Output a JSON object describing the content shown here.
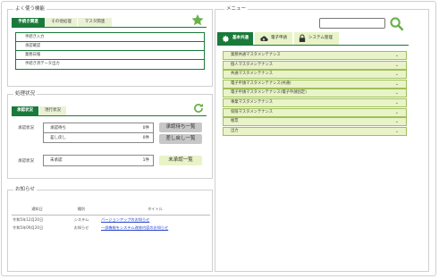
{
  "favorites": {
    "title": "よく使う機能",
    "tabs": [
      "手続き関連",
      "その他処理",
      "マスタ関連"
    ],
    "items": [
      "手続き入力",
      "承認確認",
      "業務日報",
      "手続き済データ出力"
    ]
  },
  "status": {
    "title": "処理状況",
    "tabs": [
      "承認状況",
      "現行状況"
    ],
    "rows": [
      {
        "label": "承認状況",
        "name": "承認待ち",
        "count": "0件",
        "button": "承認待ち一覧"
      },
      {
        "label": "",
        "name": "差し戻し",
        "count": "0件",
        "button": "差し戻し一覧"
      },
      {
        "label": "承認状況",
        "name": "未承認",
        "count": "1件",
        "button": "未承認一覧"
      }
    ]
  },
  "news": {
    "title": "お知らせ",
    "headers": [
      "通知日",
      "種別",
      "タイトル"
    ],
    "rows": [
      {
        "date": "令和5年12月20日",
        "type": "システム",
        "title": "バージョンアップのお知らせ"
      },
      {
        "date": "令和5年09月20日",
        "type": "お知らせ",
        "title": "一部機能をシステム改修内容のお知らせ"
      }
    ]
  },
  "menu": {
    "title": "メニュー",
    "search_placeholder": "",
    "tabs": [
      {
        "label": "基本共通",
        "icon": "gear-icon"
      },
      {
        "label": "電子申請",
        "icon": "cloud-upload-icon"
      },
      {
        "label": "システム管理",
        "icon": "lock-icon"
      }
    ],
    "items": [
      "業務共通マスタメンテナンス",
      "個人マスタメンテナンス",
      "共通マスタメンテナンス",
      "電子申請マスタメンテナンス(共通)",
      "電子申請マスタメンテナンス(電子申請固定)",
      "事業マスタメンテナンス",
      "保険マスタメンテナンス",
      "帳票",
      "出力"
    ]
  },
  "colors": {
    "primary": "#1a7a3a",
    "accent": "#6ab04c",
    "light": "#e9f3c8"
  }
}
